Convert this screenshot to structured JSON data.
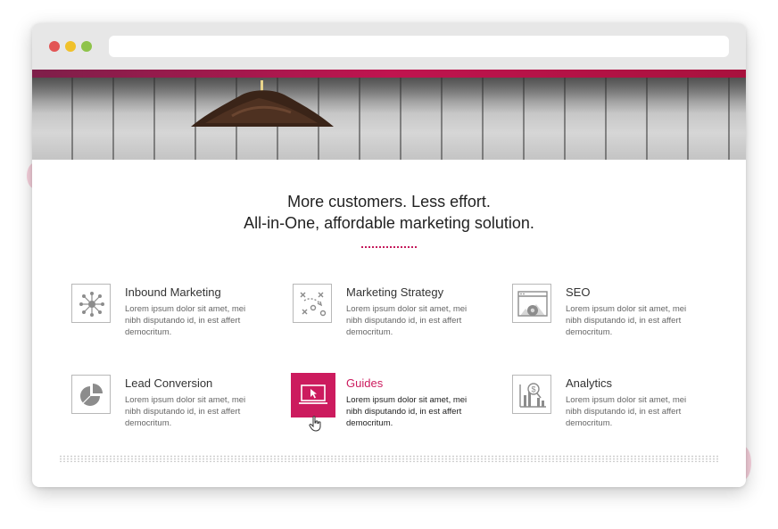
{
  "colors": {
    "accent": "#cc1b5e",
    "hero_band": "#c0144f",
    "icon_border": "#b8b8b8",
    "heading_text": "#222222"
  },
  "headline": {
    "line1": "More customers. Less effort.",
    "line2": "All-in-One, affordable marketing solution."
  },
  "features": [
    {
      "title": "Inbound Marketing",
      "icon": "network-nodes-icon",
      "description": "Lorem ipsum dolor sit amet, mei nibh disputando id, in est affert democritum.",
      "active": false
    },
    {
      "title": "Marketing Strategy",
      "icon": "strategy-play-icon",
      "description": "Lorem ipsum dolor sit amet, mei nibh disputando id, in est affert democritum.",
      "active": false
    },
    {
      "title": "SEO",
      "icon": "browser-gear-icon",
      "description": "Lorem ipsum dolor sit amet, mei nibh disputando id, in est affert democritum.",
      "active": false
    },
    {
      "title": "Lead Conversion",
      "icon": "pie-chart-icon",
      "description": "Lorem ipsum dolor sit amet, mei nibh disputando id, in est affert democritum.",
      "active": false
    },
    {
      "title": "Guides",
      "icon": "monitor-cursor-icon",
      "description": "Lorem ipsum dolor sit amet, mei nibh disputando id, in est affert democritum.",
      "active": true
    },
    {
      "title": "Analytics",
      "icon": "analytics-chart-icon",
      "description": "Lorem ipsum dolor sit amet, mei nibh disputando id, in est affert democritum.",
      "active": false
    }
  ]
}
